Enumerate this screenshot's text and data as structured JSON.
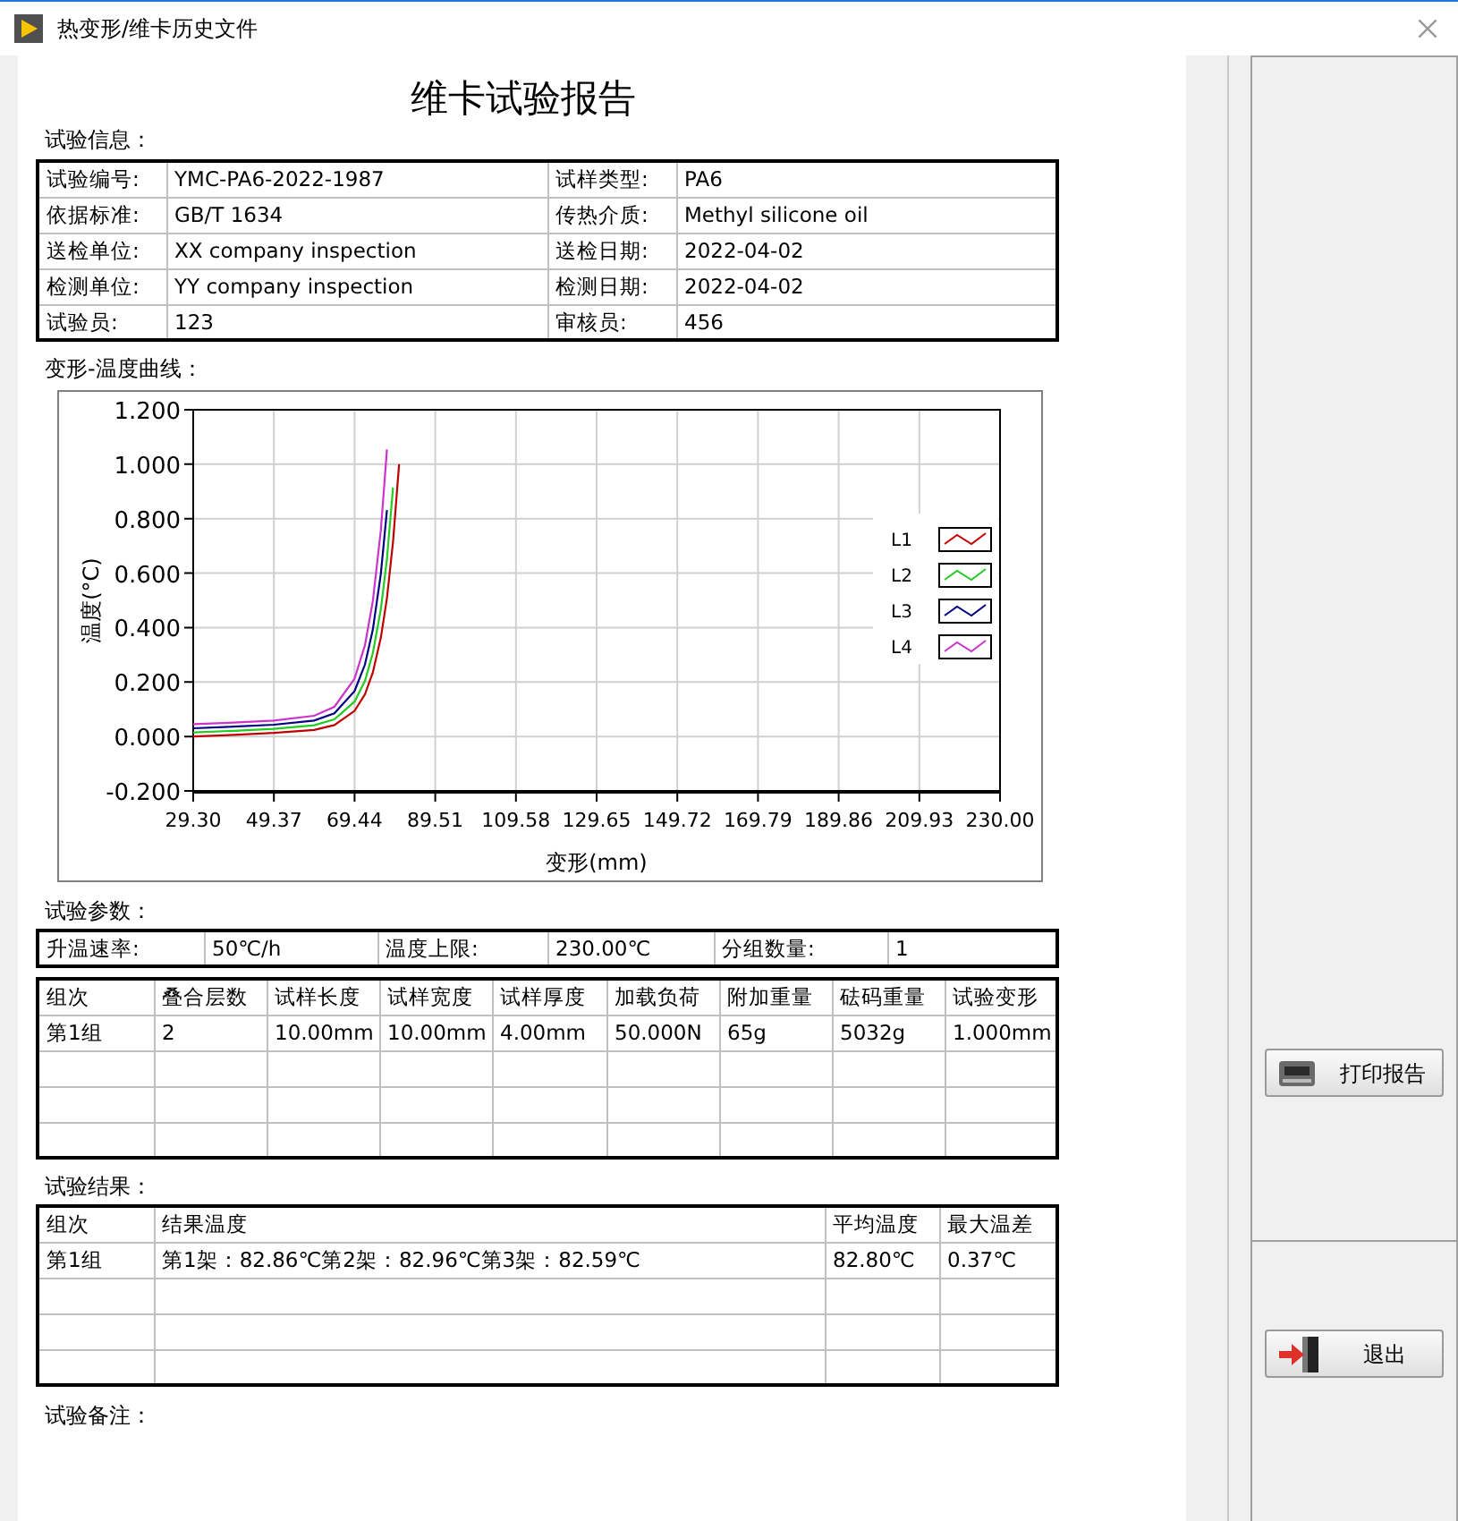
{
  "window": {
    "title": "热变形/维卡历史文件"
  },
  "report": {
    "title": "维卡试验报告",
    "info": {
      "heading": "试验信息：",
      "rows": [
        [
          "试验编号:",
          "YMC-PA6-2022-1987",
          "试样类型:",
          "PA6"
        ],
        [
          "依据标准:",
          "GB/T 1634",
          "传热介质:",
          "Methyl silicone oil"
        ],
        [
          "送检单位:",
          "XX company inspection",
          "送检日期:",
          "2022-04-02"
        ],
        [
          "检测单位:",
          "YY company inspection",
          "检测日期:",
          "2022-04-02"
        ],
        [
          "试验员:",
          "123",
          "审核员:",
          "456"
        ]
      ]
    },
    "curve": {
      "heading": "变形-温度曲线：",
      "chart_data": {
        "type": "line",
        "xlabel": "变形(mm)",
        "ylabel": "温度(°C)",
        "x": [
          29.3,
          39.3,
          49.37,
          59.4,
          64.4,
          69.44,
          72.0,
          74.0,
          76.0,
          77.5,
          79.0,
          80.0,
          80.5
        ],
        "series": [
          {
            "name": "L1",
            "color": "#c00000",
            "values": [
              0.0,
              0.006,
              0.013,
              0.024,
              0.042,
              0.094,
              0.155,
              0.235,
              0.363,
              0.508,
              0.715,
              0.9,
              1.0
            ]
          },
          {
            "name": "L2",
            "color": "#22cc22",
            "values": [
              0.015,
              0.021,
              0.028,
              0.041,
              0.063,
              0.128,
              0.204,
              0.306,
              0.468,
              0.652,
              0.915,
              null,
              null
            ]
          },
          {
            "name": "L3",
            "color": "#000080",
            "values": [
              0.03,
              0.036,
              0.043,
              0.058,
              0.085,
              0.167,
              0.264,
              0.392,
              0.598,
              0.831,
              null,
              null,
              null
            ]
          },
          {
            "name": "L4",
            "color": "#cc33cc",
            "values": [
              0.045,
              0.051,
              0.058,
              0.076,
              0.109,
              0.212,
              0.335,
              0.497,
              0.758,
              1.054,
              null,
              null,
              null
            ]
          }
        ],
        "grid": true,
        "legend": true,
        "xlim": [
          29.3,
          230.0
        ],
        "ylim": [
          -0.2,
          1.2
        ],
        "xticks": [
          {
            "value": 29.3,
            "label": "29.30"
          },
          {
            "value": 49.37,
            "label": "49.37"
          },
          {
            "value": 69.44,
            "label": "69.44"
          },
          {
            "value": 89.51,
            "label": "89.51"
          },
          {
            "value": 109.58,
            "label": "109.58"
          },
          {
            "value": 129.65,
            "label": "129.65"
          },
          {
            "value": 149.72,
            "label": "149.72"
          },
          {
            "value": 169.79,
            "label": "169.79"
          },
          {
            "value": 189.86,
            "label": "189.86"
          },
          {
            "value": 209.93,
            "label": "209.93"
          },
          {
            "value": 230.0,
            "label": "230.00"
          }
        ],
        "yticks": [
          {
            "value": 1.2,
            "label": "1.200"
          },
          {
            "value": 1.0,
            "label": "1.000"
          },
          {
            "value": 0.8,
            "label": "0.800"
          },
          {
            "value": 0.6,
            "label": "0.600"
          },
          {
            "value": 0.4,
            "label": "0.400"
          },
          {
            "value": 0.2,
            "label": "0.200"
          },
          {
            "value": 0.0,
            "label": "0.000"
          },
          {
            "value": -0.2,
            "label": "-0.200"
          }
        ]
      }
    },
    "params": {
      "heading": "试验参数：",
      "cells": [
        "升温速率:",
        "50℃/h",
        "温度上限:",
        "230.00℃",
        "分组数量:",
        "1"
      ],
      "columns": [
        "组次",
        "叠合层数",
        "试样长度",
        "试样宽度",
        "试样厚度",
        "加载负荷",
        "附加重量",
        "砝码重量",
        "试验变形"
      ],
      "rows": [
        [
          "第1组",
          "2",
          "10.00mm",
          "10.00mm",
          "4.00mm",
          "50.000N",
          "65g",
          "5032g",
          "1.000mm"
        ]
      ]
    },
    "results": {
      "heading": "试验结果：",
      "columns": [
        "组次",
        "结果温度",
        "平均温度",
        "最大温差"
      ],
      "rows": [
        [
          "第1组",
          "第1架：82.86℃第2架：82.96℃第3架：82.59℃",
          "82.80℃",
          "0.37℃"
        ]
      ]
    },
    "remarks": {
      "heading": "试验备注："
    }
  },
  "buttons": [
    {
      "kind": "print",
      "label": "打印报告"
    },
    {
      "kind": "exit",
      "label": "退出"
    }
  ]
}
